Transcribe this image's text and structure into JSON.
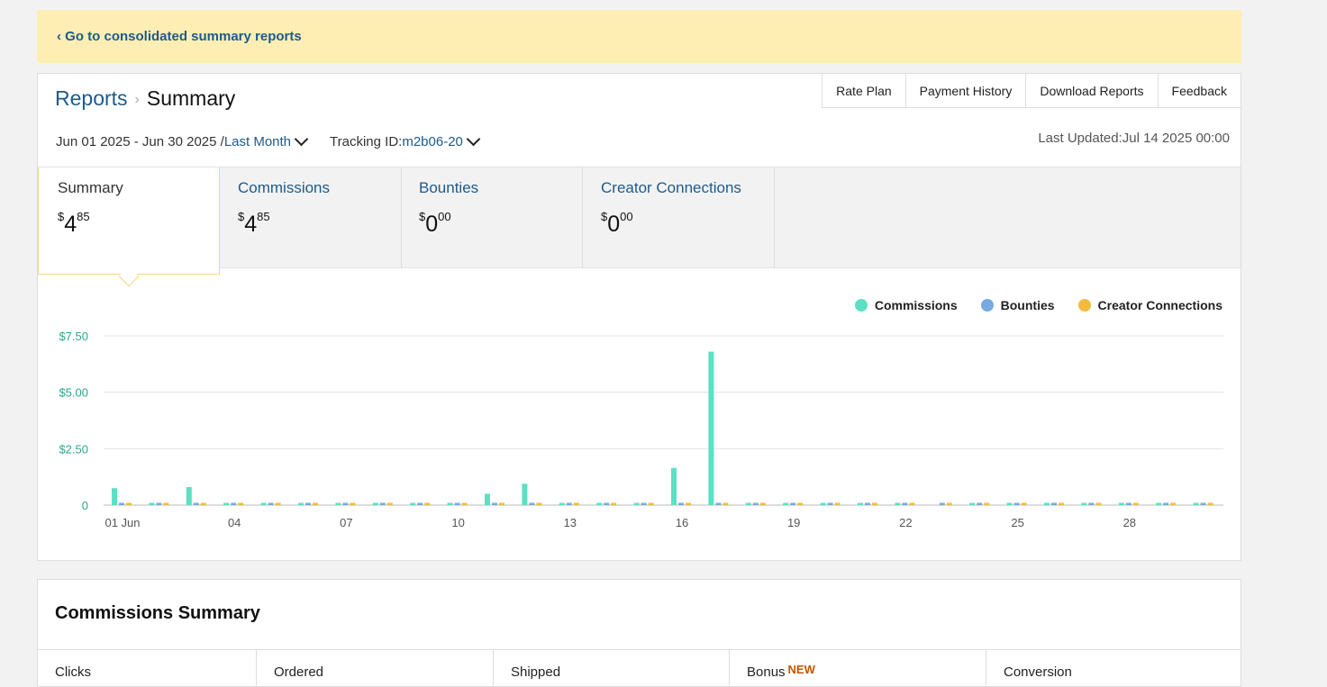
{
  "banner": {
    "link": "‹ Go to consolidated summary reports"
  },
  "breadcrumb": {
    "parent": "Reports",
    "separator": "›",
    "current": "Summary"
  },
  "top_tabs": [
    "Rate Plan",
    "Payment History",
    "Download Reports",
    "Feedback"
  ],
  "filters": {
    "date_range": "Jun 01 2025 - Jun 30 2025 /",
    "period": "Last Month",
    "tracking_label": "Tracking ID:",
    "tracking_id": "m2b06-20"
  },
  "last_updated": "Last Updated:Jul 14 2025 00:00",
  "metrics": [
    {
      "label": "Summary",
      "currency": "$",
      "whole": "4",
      "cents": "85"
    },
    {
      "label": "Commissions",
      "currency": "$",
      "whole": "4",
      "cents": "85"
    },
    {
      "label": "Bounties",
      "currency": "$",
      "whole": "0",
      "cents": "00"
    },
    {
      "label": "Creator Connections",
      "currency": "$",
      "whole": "0",
      "cents": "00"
    }
  ],
  "colors": {
    "commissions": "#5ce0c3",
    "bounties": "#78a9e0",
    "creator_connections": "#f2bb3d",
    "axis_label": "#2aa68f"
  },
  "chart_data": {
    "type": "bar",
    "categories": [
      "01 Jun",
      "02",
      "03",
      "04",
      "05",
      "06",
      "07",
      "08",
      "09",
      "10",
      "11",
      "12",
      "13",
      "14",
      "15",
      "16",
      "17",
      "18",
      "19",
      "20",
      "21",
      "22",
      "23",
      "24",
      "25",
      "26",
      "27",
      "28",
      "29",
      "30"
    ],
    "x_tick_labels": [
      "01 Jun",
      "04",
      "07",
      "10",
      "13",
      "16",
      "19",
      "22",
      "25",
      "28"
    ],
    "y_tick_labels": [
      "0",
      "$2.50",
      "$5.00",
      "$7.50"
    ],
    "ylim": [
      0,
      7.5
    ],
    "legend_position": "top-right",
    "grid": true,
    "series": [
      {
        "name": "Commissions",
        "values": [
          0.75,
          0.1,
          0.8,
          0.1,
          0.1,
          0.1,
          0.1,
          0.1,
          0.1,
          0.1,
          0.5,
          0.95,
          0.1,
          0.1,
          0.1,
          1.65,
          6.8,
          0.1,
          0.1,
          0.1,
          0.1,
          0.1,
          0,
          0.1,
          0.1,
          0.1,
          0.1,
          0.1,
          0.1,
          0.1
        ]
      },
      {
        "name": "Bounties",
        "values": [
          0.1,
          0.1,
          0.1,
          0.1,
          0.1,
          0.1,
          0.1,
          0.1,
          0.1,
          0.1,
          0.1,
          0.1,
          0.1,
          0.1,
          0.1,
          0.1,
          0.1,
          0.1,
          0.1,
          0.1,
          0.1,
          0.1,
          0.1,
          0.1,
          0.1,
          0.1,
          0.1,
          0.1,
          0.1,
          0.1
        ]
      },
      {
        "name": "Creator Connections",
        "values": [
          0.1,
          0.1,
          0.1,
          0.1,
          0.1,
          0.1,
          0.1,
          0.1,
          0.1,
          0.1,
          0.1,
          0.1,
          0.1,
          0.1,
          0.1,
          0.1,
          0.1,
          0.1,
          0.1,
          0.1,
          0.1,
          0.1,
          0.1,
          0.1,
          0.1,
          0.1,
          0.1,
          0.1,
          0.1,
          0.1
        ]
      }
    ]
  },
  "commissions_summary": {
    "title": "Commissions Summary",
    "columns": [
      "Clicks",
      "Ordered",
      "Shipped",
      "Bonus",
      "Conversion"
    ],
    "bonus_badge": "NEW"
  }
}
